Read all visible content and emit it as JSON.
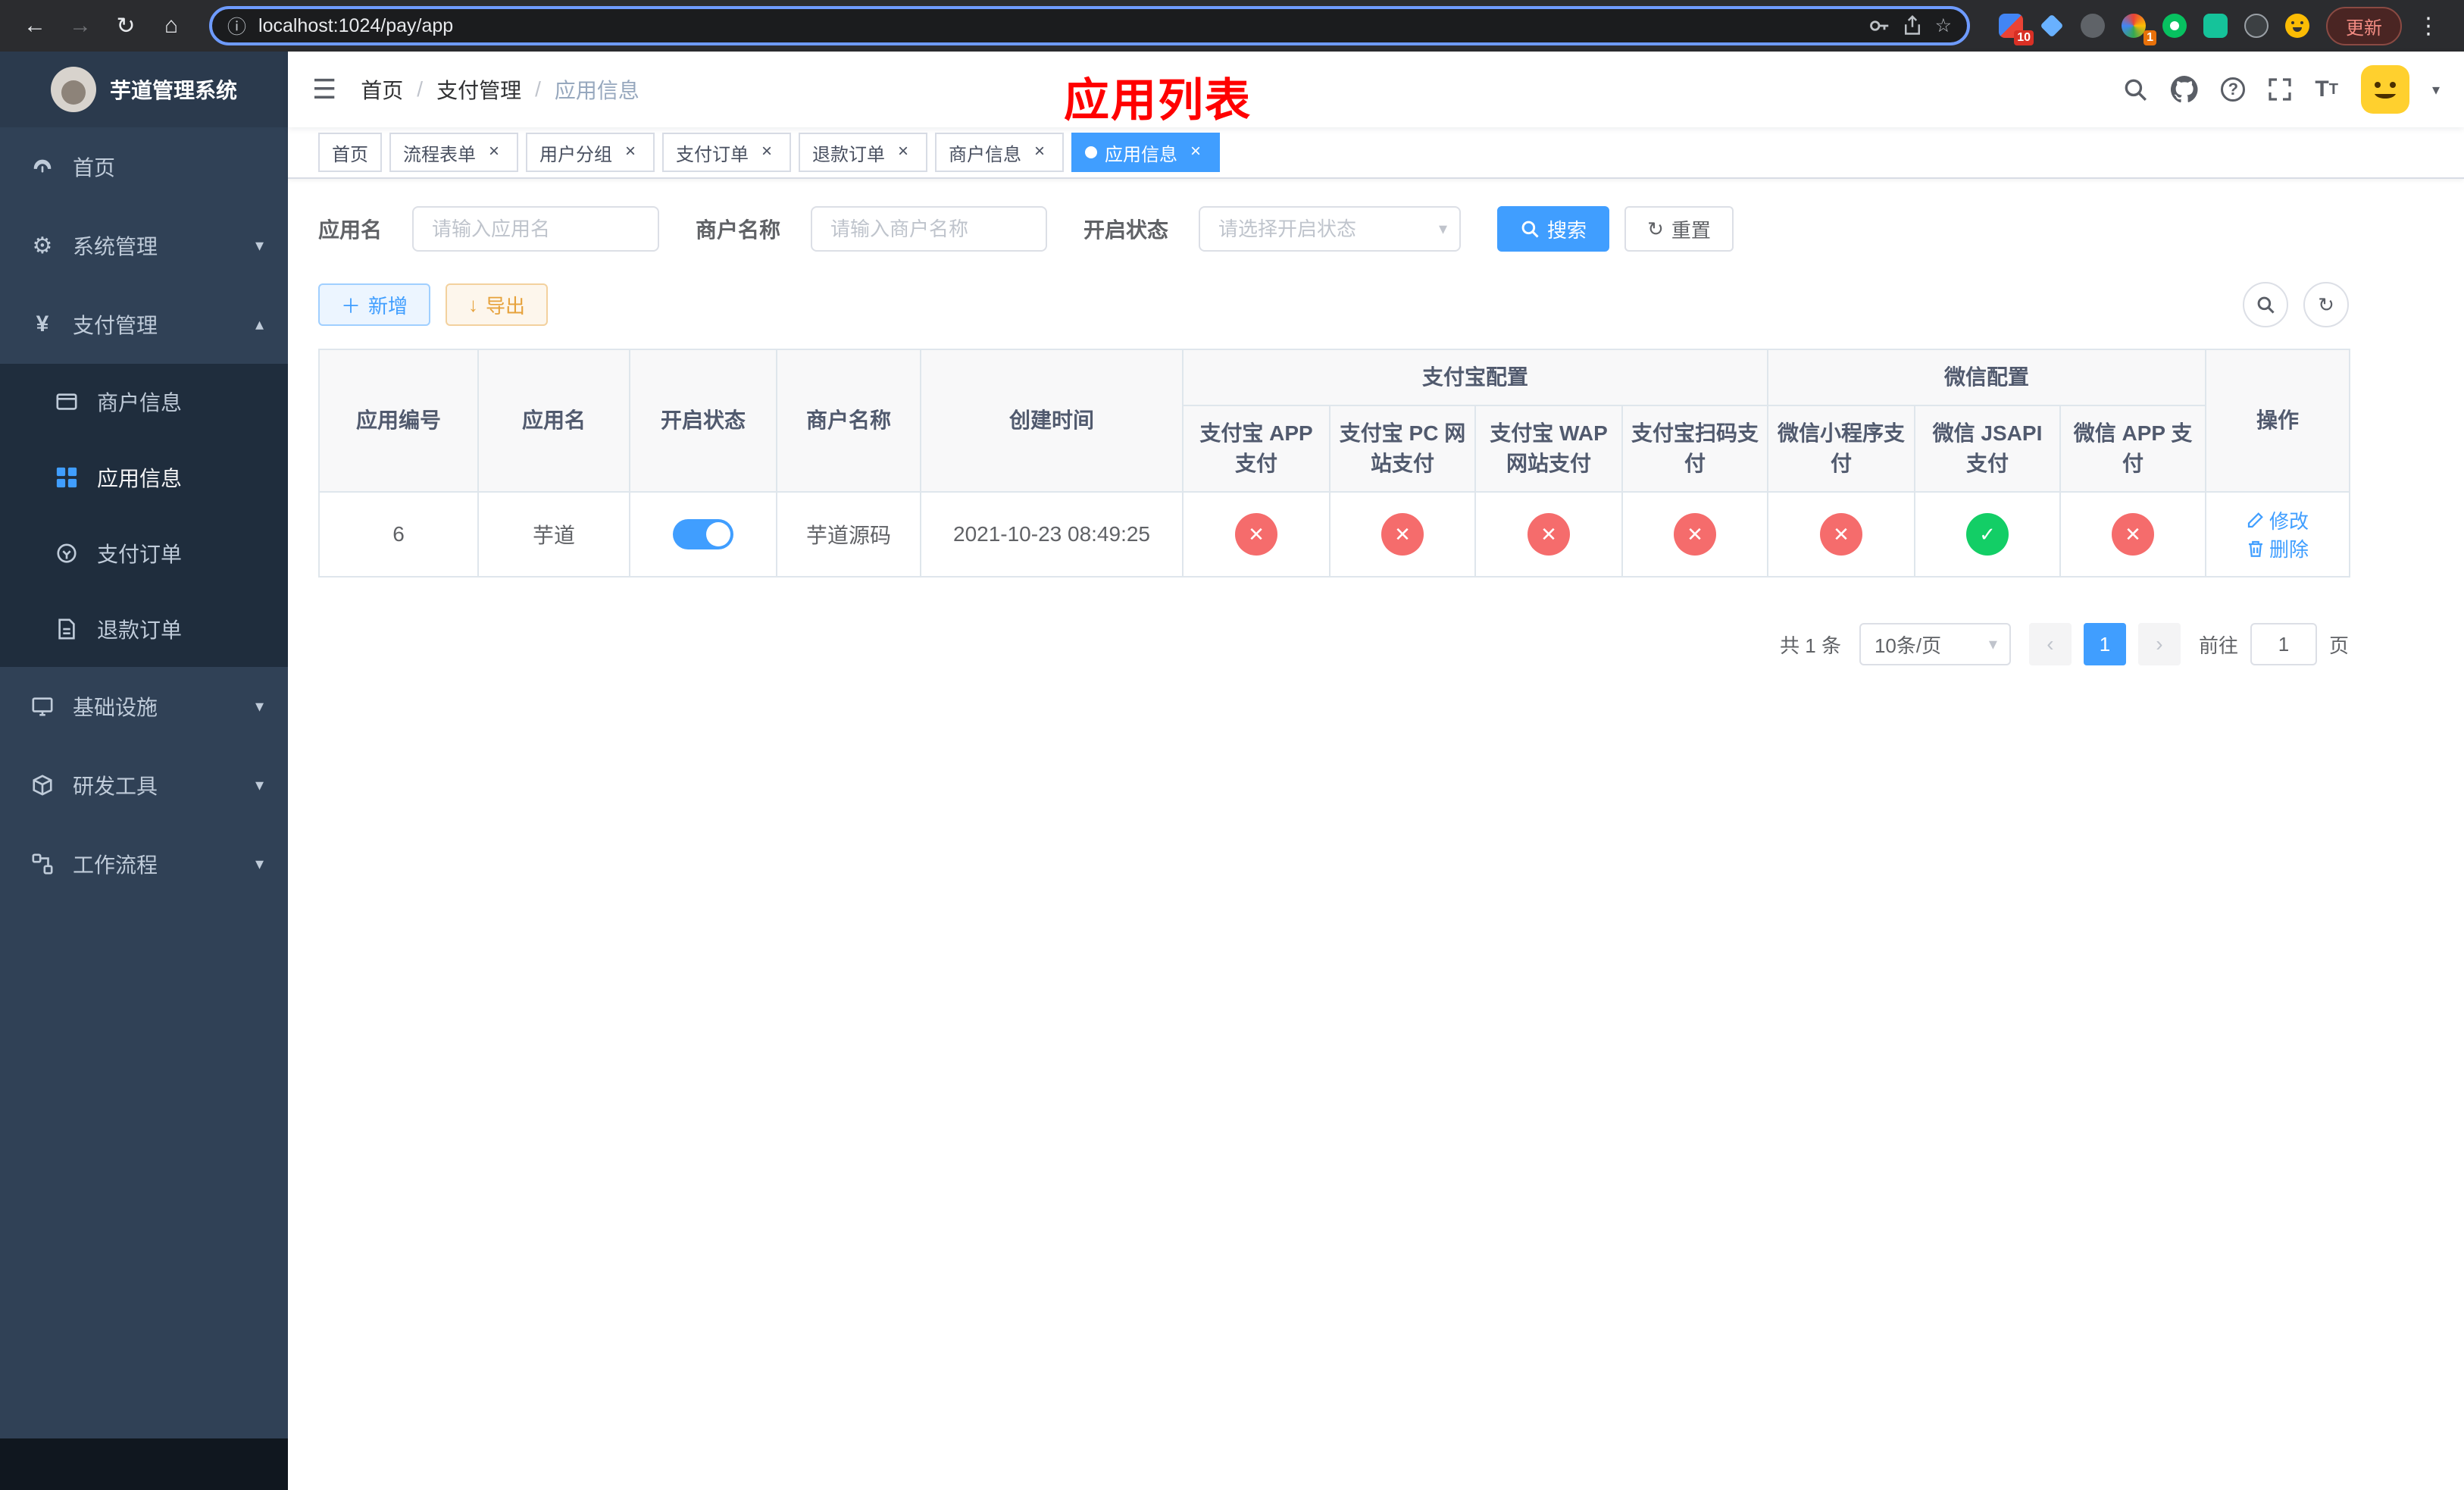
{
  "browser": {
    "url": "localhost:1024/pay/app",
    "update_button": "更新",
    "ext_badge_1": "10",
    "ext_badge_2": "1"
  },
  "sidebar": {
    "logo_title": "芋道管理系统",
    "items": [
      {
        "label": "首页"
      },
      {
        "label": "系统管理"
      },
      {
        "label": "支付管理"
      },
      {
        "label": "基础设施"
      },
      {
        "label": "研发工具"
      },
      {
        "label": "工作流程"
      }
    ],
    "payment_children": [
      {
        "label": "商户信息"
      },
      {
        "label": "应用信息"
      },
      {
        "label": "支付订单"
      },
      {
        "label": "退款订单"
      }
    ]
  },
  "header": {
    "breadcrumb": [
      "首页",
      "支付管理",
      "应用信息"
    ],
    "annotation": "应用列表"
  },
  "tabs": [
    {
      "label": "首页"
    },
    {
      "label": "流程表单"
    },
    {
      "label": "用户分组"
    },
    {
      "label": "支付订单"
    },
    {
      "label": "退款订单"
    },
    {
      "label": "商户信息"
    },
    {
      "label": "应用信息"
    }
  ],
  "filters": {
    "app_name_label": "应用名",
    "app_name_placeholder": "请输入应用名",
    "merchant_label": "商户名称",
    "merchant_placeholder": "请输入商户名称",
    "status_label": "开启状态",
    "status_placeholder": "请选择开启状态",
    "search_button": "搜索",
    "reset_button": "重置"
  },
  "toolbar": {
    "add_label": "新增",
    "export_label": "导出"
  },
  "table": {
    "columns": [
      "应用编号",
      "应用名",
      "开启状态",
      "商户名称",
      "创建时间"
    ],
    "group_alipay": {
      "label": "支付宝配置",
      "children": [
        "支付宝 APP 支付",
        "支付宝 PC 网站支付",
        "支付宝 WAP 网站支付",
        "支付宝扫码支付"
      ]
    },
    "group_wechat": {
      "label": "微信配置",
      "children": [
        "微信小程序支付",
        "微信 JSAPI 支付",
        "微信 APP 支付"
      ]
    },
    "op_column": "操作",
    "rows": [
      {
        "id": "6",
        "name": "芋道",
        "enabled": true,
        "merchant": "芋道源码",
        "created_at": "2021-10-23 08:49:25",
        "statuses": [
          "error",
          "error",
          "error",
          "error",
          "error",
          "success",
          "error"
        ],
        "edit_label": "修改",
        "delete_label": "删除"
      }
    ]
  },
  "pagination": {
    "total": "共 1 条",
    "page_size": "10条/页",
    "page": "1",
    "goto": "前往",
    "goto_value": "1",
    "unit": "页"
  },
  "colors": {
    "accent": "#409eff",
    "error": "#f56c6c",
    "success": "#13ce66",
    "sidebar": "#304156"
  }
}
